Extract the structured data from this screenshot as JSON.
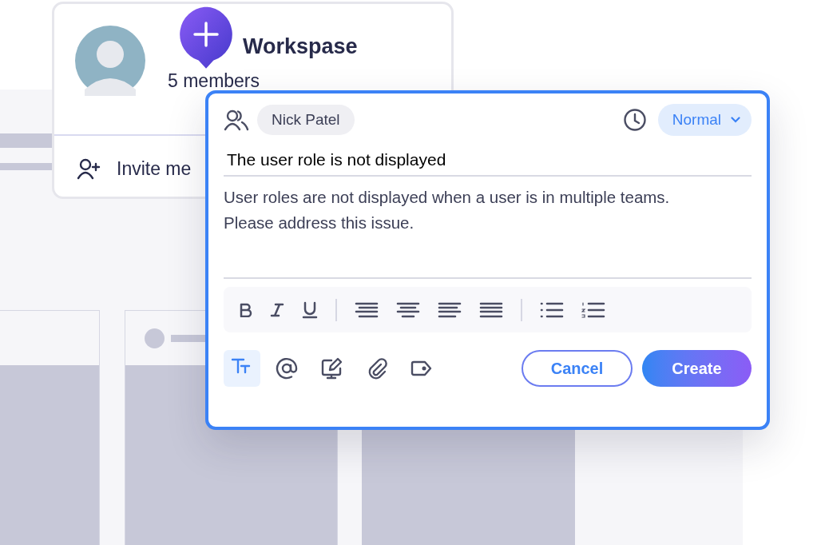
{
  "workspace": {
    "title": "Workspase",
    "members": "5 members",
    "invite": "Invite me"
  },
  "issue": {
    "assignee": "Nick Patel",
    "priority": "Normal",
    "title": "The user role is not displayed",
    "description": "User roles are not displayed when a user is in multiple teams. Please address this issue."
  },
  "insert_tools": [
    {
      "kind": "text-format",
      "selected": true
    },
    {
      "kind": "mention",
      "selected": false
    },
    {
      "kind": "draw",
      "selected": false
    },
    {
      "kind": "attach",
      "selected": false
    },
    {
      "kind": "tag",
      "selected": false
    }
  ],
  "buttons": {
    "cancel": "Cancel",
    "create": "Create"
  }
}
